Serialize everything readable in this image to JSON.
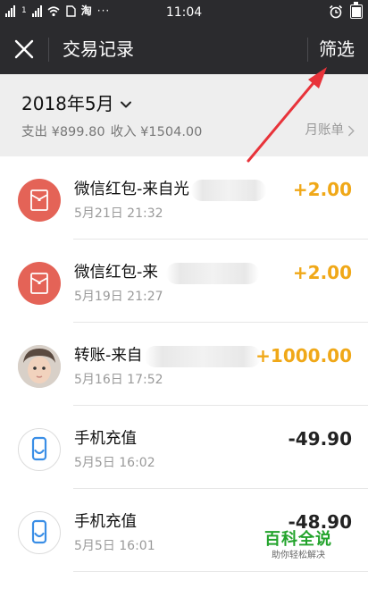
{
  "status_bar": {
    "carrier_label": "1",
    "app_glyph": "淘",
    "more": "···",
    "time": "11:04"
  },
  "nav": {
    "title": "交易记录",
    "filter_label": "筛选",
    "close_icon": "close-icon"
  },
  "summary": {
    "month": "2018年5月",
    "expense": "支出 ¥899.80",
    "income": "收入 ¥1504.00",
    "monthly_bill": "月账单"
  },
  "transactions": [
    {
      "name": "微信红包-来自光",
      "time": "5月21日 21:32",
      "amount": "+2.00",
      "type": "income",
      "icon": "red-packet-icon"
    },
    {
      "name": "微信红包-来",
      "time": "5月19日 21:27",
      "amount": "+2.00",
      "type": "income",
      "icon": "red-packet-icon"
    },
    {
      "name": "转账-来自",
      "time": "5月16日 17:52",
      "amount": "+1000.00",
      "type": "income",
      "icon": "avatar-photo"
    },
    {
      "name": "手机充值",
      "time": "5月5日 16:02",
      "amount": "-49.90",
      "type": "expense",
      "icon": "phone-recharge-icon"
    },
    {
      "name": "手机充值",
      "time": "5月5日 16:01",
      "amount": "-48.90",
      "type": "expense",
      "icon": "phone-recharge-icon"
    }
  ],
  "watermark": {
    "title": "百科全说",
    "subtitle": "助你轻松解决"
  },
  "colors": {
    "nav_bg": "#2b2b2e",
    "income": "#f0a818",
    "red_packet": "#e46357",
    "annotation_arrow": "#e8333a",
    "watermark_green": "#22a32b"
  }
}
